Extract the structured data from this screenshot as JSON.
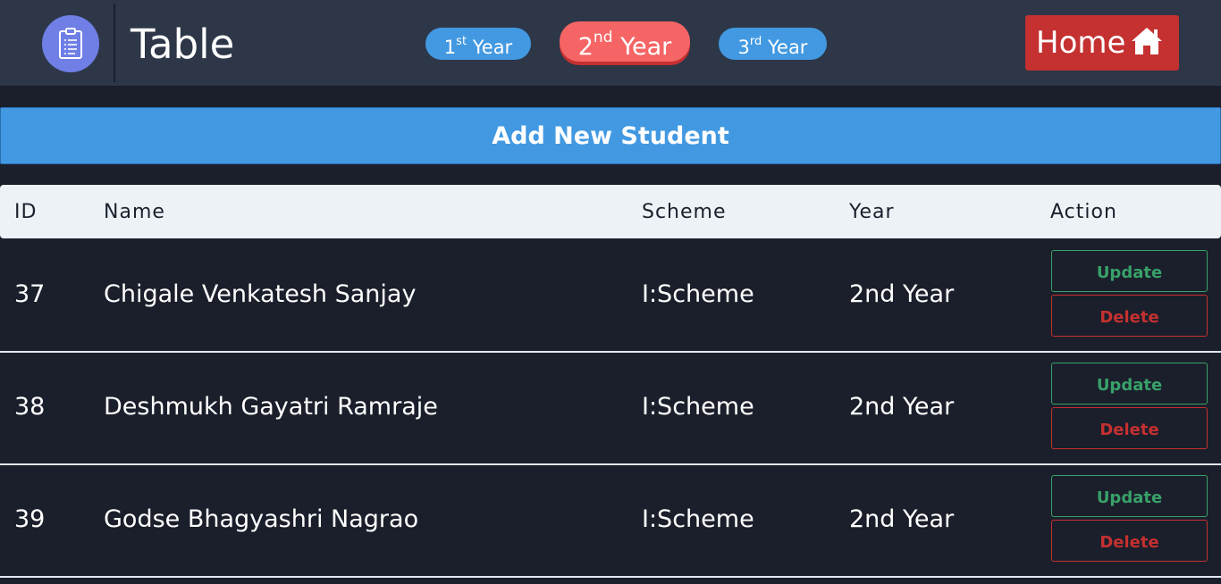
{
  "header": {
    "title": "Table",
    "logo_icon": "clipboard-icon",
    "year_tabs": [
      {
        "num": "1",
        "suffix": "st",
        "word": "Year"
      },
      {
        "num": "2",
        "suffix": "nd",
        "word": "Year"
      },
      {
        "num": "3",
        "suffix": "rd",
        "word": "Year"
      }
    ],
    "active_tab": "2nd Year",
    "home_label": "Home",
    "home_icon": "home-icon"
  },
  "main": {
    "add_label": "Add New Student"
  },
  "table": {
    "columns": [
      "ID",
      "Name",
      "Scheme",
      "Year",
      "Action"
    ],
    "rows": [
      {
        "id": "37",
        "name": "Chigale Venkatesh Sanjay",
        "scheme": "I:Scheme",
        "year": "2nd Year",
        "update": "Update",
        "delete": "Delete"
      },
      {
        "id": "38",
        "name": "Deshmukh Gayatri Ramraje",
        "scheme": "I:Scheme",
        "year": "2nd Year",
        "update": "Update",
        "delete": "Delete"
      },
      {
        "id": "39",
        "name": "Godse Bhagyashri Nagrao",
        "scheme": "I:Scheme",
        "year": "2nd Year",
        "update": "Update",
        "delete": "Delete"
      }
    ]
  },
  "colors": {
    "header_bg": "#2d3748",
    "page_bg": "#1b1f2b",
    "accent_blue": "#4299e1",
    "active_red": "#f56565",
    "home_red": "#c53030",
    "update_green": "#38a169",
    "delete_red": "#c53030"
  }
}
